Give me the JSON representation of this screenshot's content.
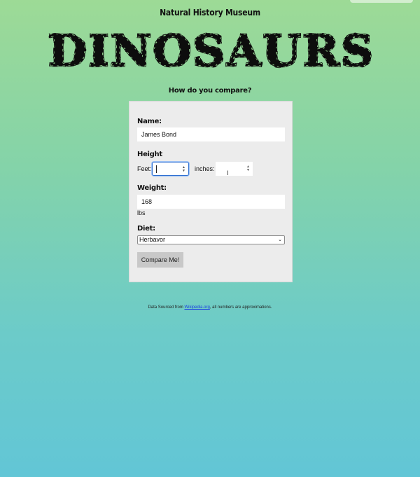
{
  "header": {
    "site_name": "Natural History Museum",
    "logo_text": "DINOSAURS",
    "tagline": "How do you compare?"
  },
  "form": {
    "name_label": "Name:",
    "name_value": "James Bond",
    "height_label": "Height",
    "feet_label": "Feet:",
    "feet_value": "",
    "inches_label": "inches:",
    "inches_value": "",
    "weight_label": "Weight:",
    "weight_value": "168",
    "weight_unit": "lbs",
    "diet_label": "Diet:",
    "diet_selected": "Herbavor",
    "submit_label": "Compare Me!"
  },
  "footer": {
    "prefix": "Data Sourced from ",
    "link_text": "Wikipedia.org",
    "suffix": ", all numbers are approximations."
  },
  "icons": {
    "spinner": "up-down-spinner-icon",
    "select_arrow": "chevron-down-icon",
    "cursor": "text-cursor-icon"
  },
  "colors": {
    "gradient_top": "#9dda96",
    "gradient_bottom": "#62c6d6",
    "card_bg": "#ececec",
    "focus": "#2f6fd1",
    "link": "#1a3de0"
  }
}
